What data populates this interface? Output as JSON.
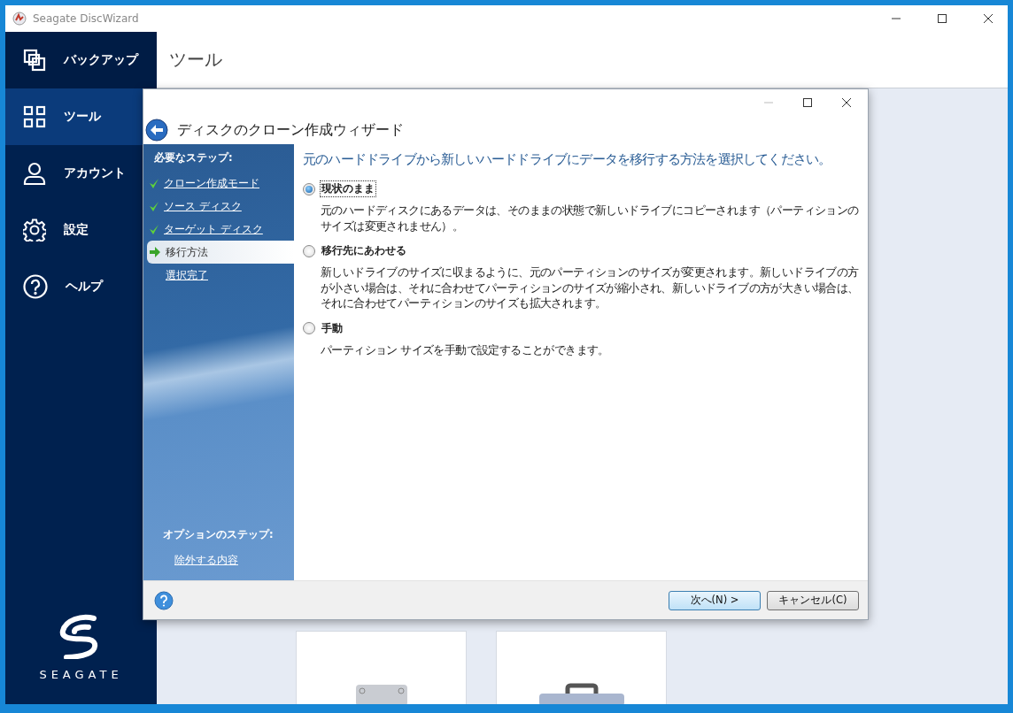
{
  "window": {
    "title": "Seagate DiscWizard"
  },
  "sidebar": {
    "items": [
      {
        "label": "バックアップ",
        "kind": "backup",
        "selected": false
      },
      {
        "label": "ツール",
        "kind": "tools",
        "selected": true
      },
      {
        "label": "アカウント",
        "kind": "account",
        "selected": false
      },
      {
        "label": "設定",
        "kind": "settings",
        "selected": false
      },
      {
        "label": "ヘルプ",
        "kind": "help",
        "selected": false
      }
    ],
    "logo_text": "SEAGATE"
  },
  "page": {
    "title": "ツール"
  },
  "wizard": {
    "title": "ディスクのクローン作成ウィザード",
    "required_heading": "必要なステップ:",
    "steps": [
      {
        "label": "クローン作成モード",
        "kind": "done"
      },
      {
        "label": "ソース ディスク",
        "kind": "done"
      },
      {
        "label": "ターゲット ディスク",
        "kind": "done"
      },
      {
        "label": "移行方法",
        "kind": "current"
      },
      {
        "label": "選択完了",
        "kind": "todo"
      }
    ],
    "optional_heading": "オプションのステップ:",
    "optional_steps": [
      {
        "label": "除外する内容",
        "kind": "todo"
      }
    ],
    "question": "元のハードドライブから新しいハードドライブにデータを移行する方法を選択してください。",
    "options": [
      {
        "label": "現状のまま",
        "selected": true,
        "description": "元のハードディスクにあるデータは、そのままの状態で新しいドライブにコピーされます（パーティションのサイズは変更されません）。"
      },
      {
        "label": "移行先にあわせる",
        "selected": false,
        "description": "新しいドライブのサイズに収まるように、元のパーティションのサイズが変更されます。新しいドライブの方が小さい場合は、それに合わせてパーティションのサイズが縮小され、新しいドライブの方が大きい場合は、それに合わせてパーティションのサイズも拡大されます。"
      },
      {
        "label": "手動",
        "selected": false,
        "description": "パーティション サイズを手動で設定することができます。"
      }
    ],
    "buttons": [
      {
        "label": "次へ(N) >",
        "kind": "primary"
      },
      {
        "label": "キャンセル(C)",
        "kind": "default"
      }
    ]
  }
}
